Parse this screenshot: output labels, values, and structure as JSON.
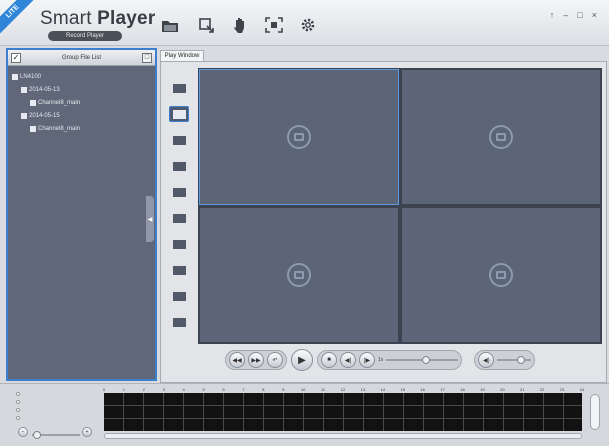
{
  "app": {
    "edition_badge": "LITE",
    "title_regular": "Smart",
    "title_bold": "Player",
    "subtitle": "Record Player"
  },
  "toolbar": {
    "icons": [
      "folder-open-icon",
      "export-icon",
      "hand-icon",
      "snapshot-area-icon",
      "settings-gear-icon"
    ]
  },
  "window_controls": {
    "pin": "↑",
    "minimize": "–",
    "maximize": "□",
    "close": "×"
  },
  "file_list": {
    "header": "Group File List",
    "checkbox_mark": "✓",
    "header_button": "□",
    "tree": [
      {
        "level": 0,
        "label": "LN4100"
      },
      {
        "level": 1,
        "label": "2014-05-13"
      },
      {
        "level": 2,
        "label": "Channel8_main"
      },
      {
        "level": 1,
        "label": "2014-05-15"
      },
      {
        "level": 2,
        "label": "Channel8_main"
      }
    ]
  },
  "play_window": {
    "tab_label": "Play Window",
    "layouts_count": 10,
    "active_layout": 1,
    "cells": 4,
    "selected_cell": 0
  },
  "controls": {
    "buttons": [
      "slow-icon",
      "fast-icon",
      "rewind-icon",
      "play-icon",
      "stop-icon",
      "step-back-icon",
      "step-forward-icon"
    ],
    "speed_label": "1x",
    "speed_slider_value": 0.55,
    "volume_icon": "speaker-icon",
    "volume_value": 0.7
  },
  "timeline": {
    "hours": [
      "0",
      "1",
      "2",
      "3",
      "4",
      "5",
      "6",
      "7",
      "8",
      "9",
      "10",
      "11",
      "12",
      "13",
      "14",
      "15",
      "16",
      "17",
      "18",
      "19",
      "20",
      "21",
      "22",
      "23",
      "24"
    ],
    "zoom_value": 0.1
  }
}
